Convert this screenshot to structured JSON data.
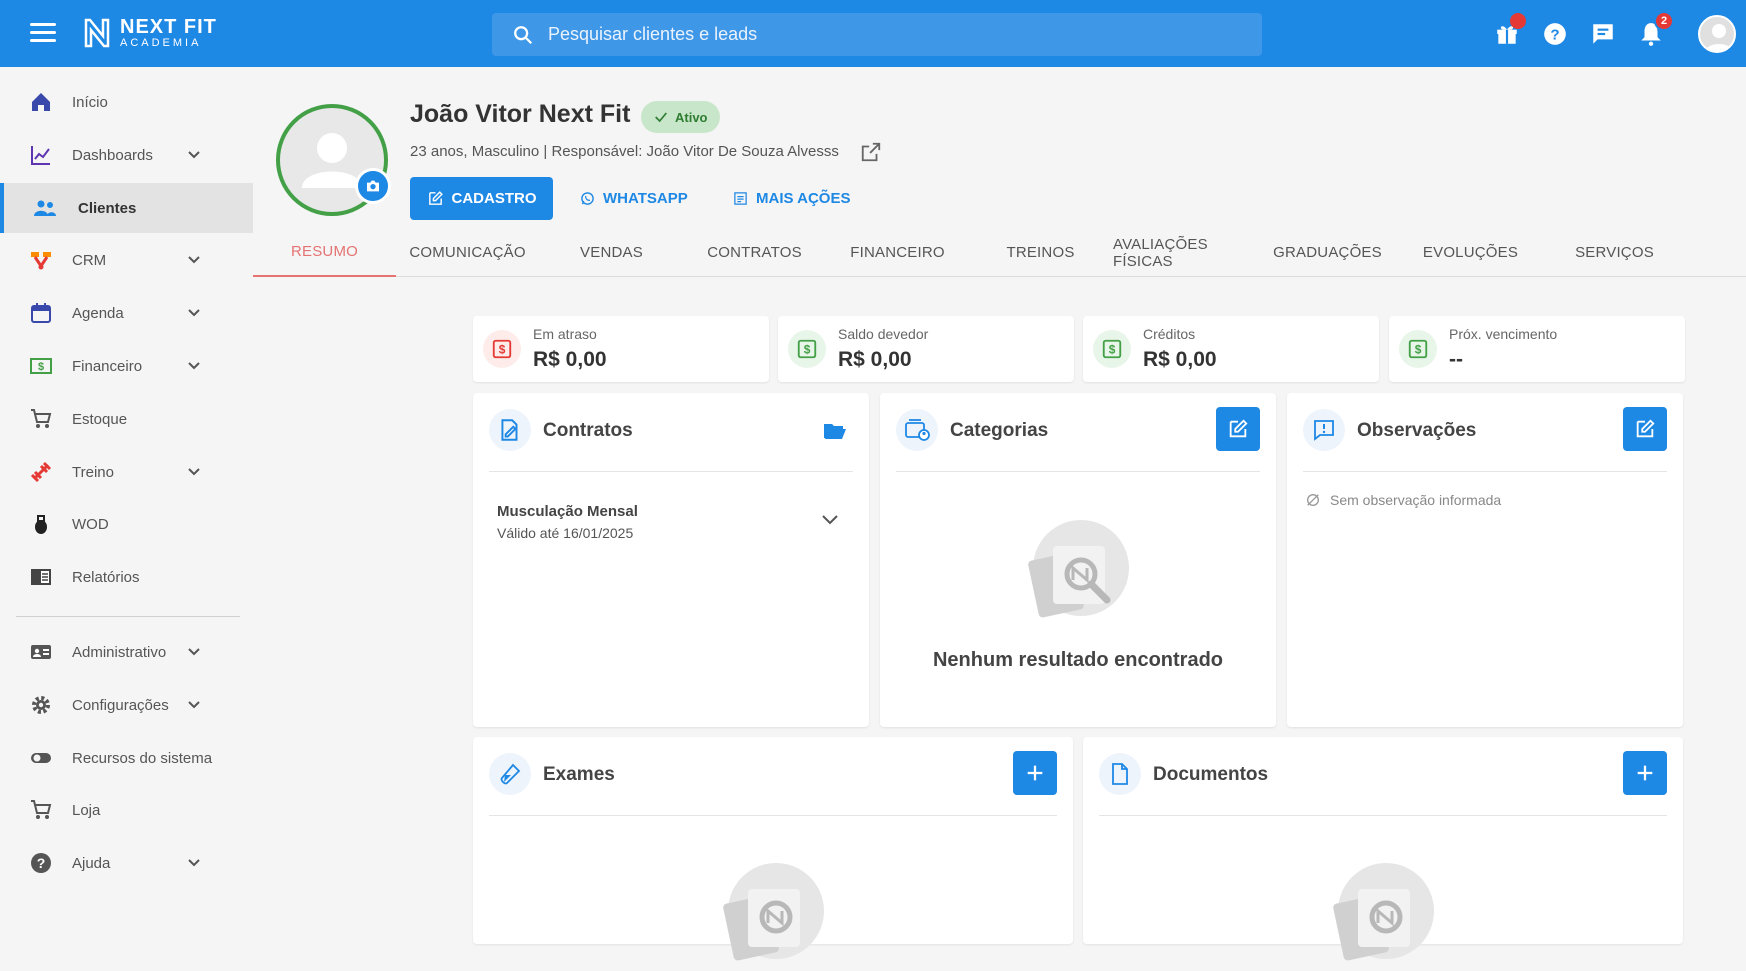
{
  "app": {
    "brand_line1": "NEXT FIT",
    "brand_line2": "ACADEMIA"
  },
  "search": {
    "placeholder": "Pesquisar clientes e leads"
  },
  "notifications": {
    "count": "2"
  },
  "sidebar": {
    "items": [
      {
        "label": "Início",
        "icon": "home-icon"
      },
      {
        "label": "Dashboards",
        "icon": "chart-icon",
        "expandable": true
      },
      {
        "label": "Clientes",
        "icon": "people-icon",
        "active": true
      },
      {
        "label": "CRM",
        "icon": "crm-icon",
        "expandable": true
      },
      {
        "label": "Agenda",
        "icon": "calendar-icon",
        "expandable": true
      },
      {
        "label": "Financeiro",
        "icon": "money-icon",
        "expandable": true
      },
      {
        "label": "Estoque",
        "icon": "cart-icon"
      },
      {
        "label": "Treino",
        "icon": "dumbbell-icon",
        "expandable": true
      },
      {
        "label": "WOD",
        "icon": "kettlebell-icon"
      },
      {
        "label": "Relatórios",
        "icon": "report-icon"
      },
      {
        "label": "Administrativo",
        "icon": "id-card-icon",
        "expandable": true
      },
      {
        "label": "Configurações",
        "icon": "gear-icon",
        "expandable": true
      },
      {
        "label": "Recursos do sistema",
        "icon": "toggle-icon"
      },
      {
        "label": "Loja",
        "icon": "cart-icon"
      },
      {
        "label": "Ajuda",
        "icon": "help-icon",
        "expandable": true
      }
    ]
  },
  "profile": {
    "name": "João Vitor Next Fit",
    "status": "Ativo",
    "subtitle": "23 anos, Masculino | Responsável: João Vitor De Souza Alvesss",
    "actions": {
      "cadastro": "CADASTRO",
      "whatsapp": "WHATSAPP",
      "mais": "MAIS AÇÕES"
    }
  },
  "tabs": [
    "RESUMO",
    "COMUNICAÇÃO",
    "VENDAS",
    "CONTRATOS",
    "FINANCEIRO",
    "TREINOS",
    "AVALIAÇÕES FÍSICAS",
    "GRADUAÇÕES",
    "EVOLUÇÕES",
    "SERVIÇOS"
  ],
  "summary": [
    {
      "label": "Em atraso",
      "value": "R$ 0,00",
      "color": "#e53935"
    },
    {
      "label": "Saldo devedor",
      "value": "R$ 0,00",
      "color": "#43a047"
    },
    {
      "label": "Créditos",
      "value": "R$ 0,00",
      "color": "#43a047"
    },
    {
      "label": "Próx. vencimento",
      "value": "--",
      "color": "#43a047"
    }
  ],
  "panels": {
    "contratos": {
      "title": "Contratos",
      "item_name": "Musculação Mensal",
      "item_valid": "Válido até 16/01/2025"
    },
    "categorias": {
      "title": "Categorias",
      "empty": "Nenhum resultado encontrado"
    },
    "observacoes": {
      "title": "Observações",
      "empty": "Sem observação informada"
    },
    "exames": {
      "title": "Exames"
    },
    "documentos": {
      "title": "Documentos"
    }
  },
  "colors": {
    "primary": "#1e88e5",
    "active_tab": "#e57373",
    "status_green": "#43a047"
  }
}
